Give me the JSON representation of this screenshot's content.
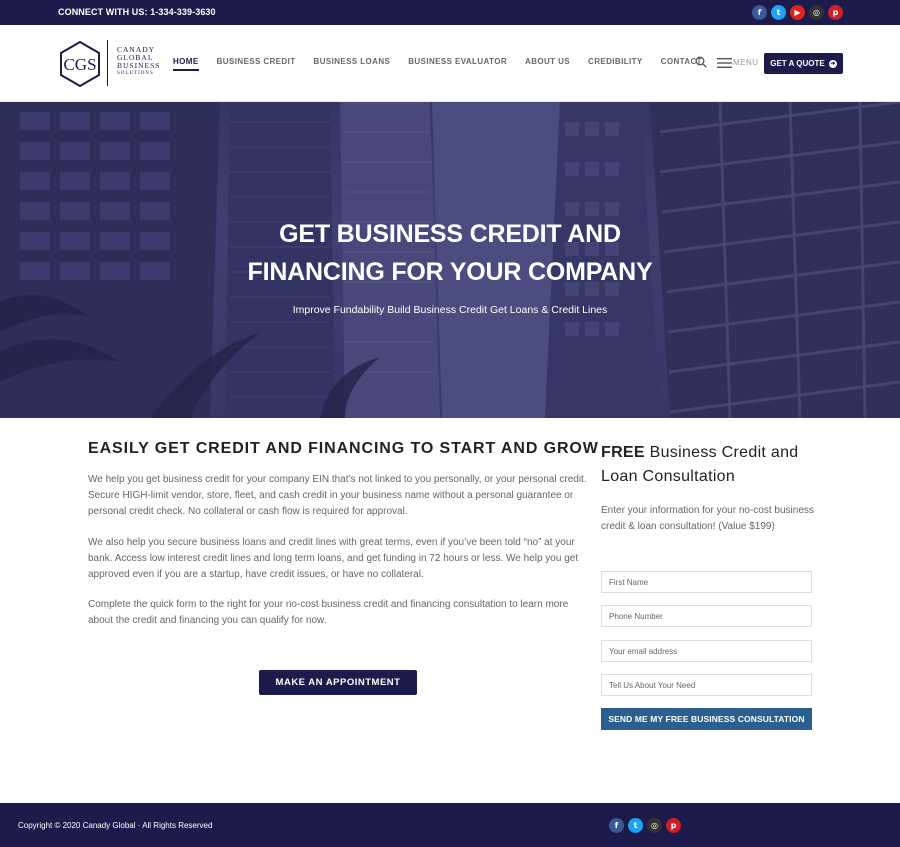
{
  "topbar": {
    "connect_text": "CONNECT WITH US: 1-334-339-3630"
  },
  "social": [
    {
      "name": "facebook",
      "glyph": "f",
      "color": "#3b5998"
    },
    {
      "name": "twitter",
      "glyph": "t",
      "color": "#1da1f2"
    },
    {
      "name": "youtube",
      "glyph": "▶",
      "color": "#e62117"
    },
    {
      "name": "instagram",
      "glyph": "◎",
      "color": "#333333"
    },
    {
      "name": "pinterest",
      "glyph": "p",
      "color": "#cb2027"
    }
  ],
  "footer_social": [
    {
      "name": "facebook",
      "glyph": "f",
      "color": "#3b5998"
    },
    {
      "name": "twitter",
      "glyph": "t",
      "color": "#1da1f2"
    },
    {
      "name": "instagram",
      "glyph": "◎",
      "color": "#333333"
    },
    {
      "name": "pinterest",
      "glyph": "p",
      "color": "#cb2027"
    }
  ],
  "logo": {
    "monogram": "CGS",
    "line1": "CANADY",
    "line2": "GLOBAL",
    "line3": "BUSINESS",
    "line4": "SOLUTIONS"
  },
  "nav": {
    "items": [
      {
        "label": "HOME",
        "active": true
      },
      {
        "label": "BUSINESS CREDIT"
      },
      {
        "label": "BUSINESS LOANS"
      },
      {
        "label": "BUSINESS EVALUATOR"
      },
      {
        "label": "ABOUT US"
      },
      {
        "label": "CREDIBILITY"
      },
      {
        "label": "CONTACT"
      }
    ],
    "menu_label": "MENU",
    "quote_label": "GET A QUOTE"
  },
  "hero": {
    "title_line1": "GET BUSINESS CREDIT AND",
    "title_line2": "FINANCING FOR YOUR COMPANY",
    "subtitle": "Improve Fundability  Build Business Credit  Get Loans & Credit Lines"
  },
  "main": {
    "heading": "EASILY GET CREDIT AND FINANCING TO START AND GROW",
    "para1": "We help you get business credit for your company EIN that’s not linked to you personally, or your personal credit. Secure HIGH-limit vendor, store, fleet, and cash credit in your business name without a personal guarantee or personal credit check. No collateral or cash flow is required for approval.",
    "para2": "We also help you secure business loans and credit lines with great terms, even if you’ve been told “no” at your bank. Access low interest credit lines and long term loans, and get funding in 72 hours or less. We help you get approved even if you are a startup, have credit issues, or have no collateral.",
    "para3": "Complete the quick form to the right for your no-cost business credit and financing consultation to learn more about the credit and financing you can qualify for now.",
    "appointment_label": "MAKE AN APPOINTMENT"
  },
  "form": {
    "title_bold": "FREE",
    "title_rest": " Business Credit and Loan Consultation",
    "description": "Enter your information for your no-cost business credit & loan consultation! (Value $199)",
    "first_name_placeholder": "First Name",
    "phone_placeholder": "Phone Number",
    "email_placeholder": "Your email address",
    "need_placeholder": "Tell Us About Your Need",
    "submit_label": "SEND ME MY FREE BUSINESS CONSULTATION"
  },
  "footer": {
    "copyright": "Copyright © 2020 Canady Global · All Rights Reserved"
  }
}
